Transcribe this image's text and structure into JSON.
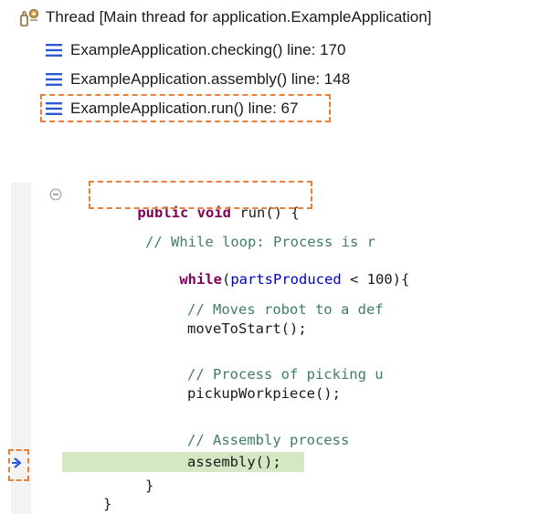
{
  "debug_stack": {
    "thread_label": "Thread [Main thread for application.ExampleApplication]",
    "frames": [
      {
        "label": "ExampleApplication.checking() line: 170"
      },
      {
        "label": "ExampleApplication.assembly() line: 148"
      },
      {
        "label": "ExampleApplication.run() line: 67"
      }
    ],
    "selected_frame_index": 2
  },
  "editor": {
    "method_signature": {
      "kw1": "public",
      "kw2": "void",
      "rest": "run() {"
    },
    "lines": {
      "c1": "// While loop: Process is r",
      "while_kw": "while",
      "while_open": "(",
      "while_field": "partsProduced",
      "while_rest": " < 100){",
      "c2": "// Moves robot to a def",
      "call1": "moveToStart();",
      "c3": "// Process of picking u",
      "call2": "pickupWorkpiece();",
      "c4": "// Assembly process",
      "call3": "assembly();",
      "brace_inner": "}",
      "brace_outer": "}"
    },
    "current_line": "assembly();"
  },
  "colors": {
    "highlight": "#e8803a",
    "keyword": "#7f0055",
    "comment": "#3f7f5f",
    "field": "#0000c0",
    "current_line_bg": "#d4e8c4"
  },
  "icons": {
    "thread": "thread-icon",
    "frame": "stack-frame-icon",
    "fold": "fold-collapse-icon",
    "instruction_pointer": "instruction-pointer-icon"
  }
}
